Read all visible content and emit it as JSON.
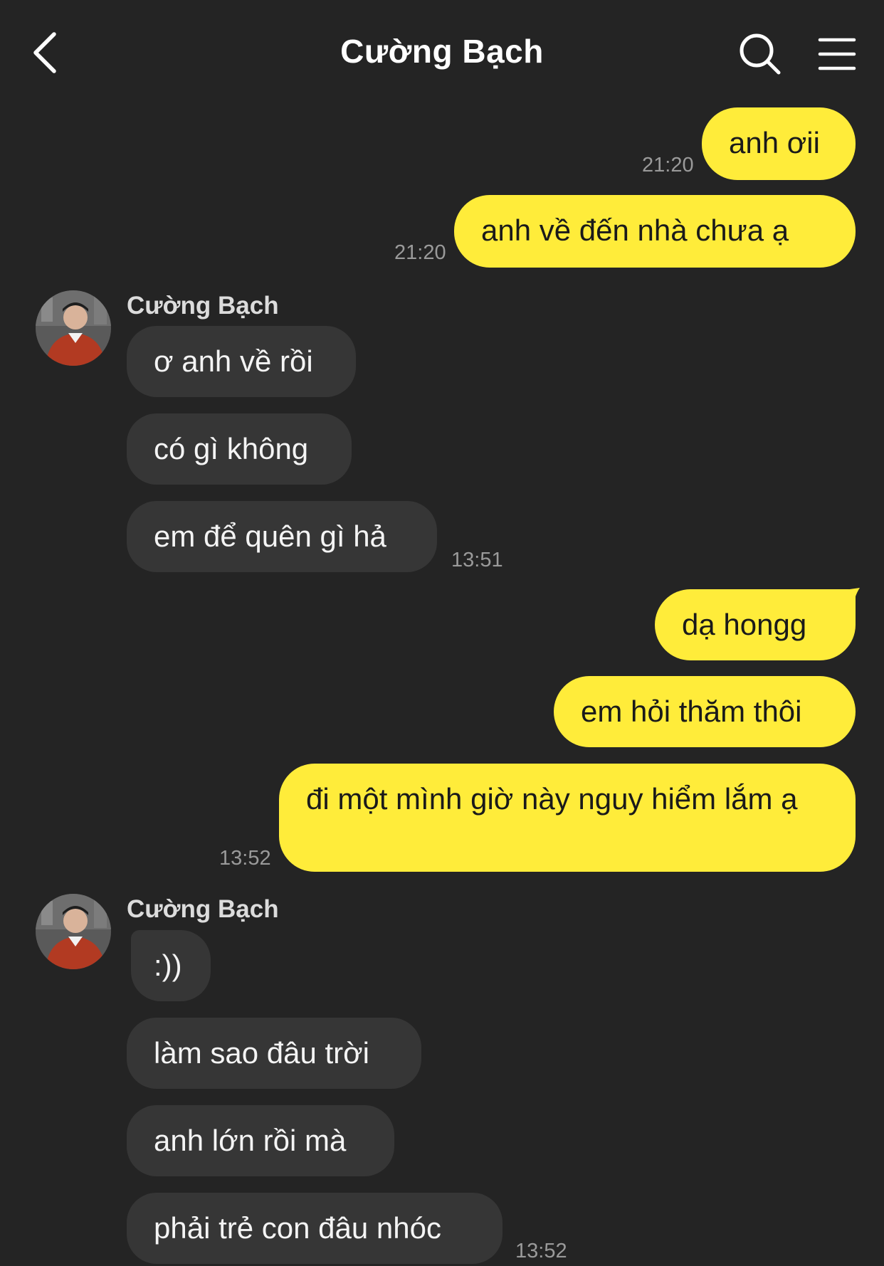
{
  "header": {
    "title": "Cường Bạch"
  },
  "messages": {
    "m1": {
      "text": "anh ơii",
      "time": "21:20"
    },
    "m2": {
      "text": "anh về đến nhà chưa ạ",
      "time": "21:20"
    },
    "group1": {
      "sender": "Cường Bạch",
      "m3": "ơ anh về rồi",
      "m4": "có gì không",
      "m5": "em để quên gì hả",
      "time": "13:51"
    },
    "m6": {
      "text": "dạ hongg"
    },
    "m7": {
      "text": "em hỏi thăm thôi"
    },
    "m8": {
      "text": "đi một mình giờ này nguy hiểm lắm ạ",
      "time": "13:52"
    },
    "group2": {
      "sender": "Cường Bạch",
      "m9": ":))",
      "m10": "làm sao đâu trời",
      "m11": "anh lớn rồi mà",
      "m12": "phải trẻ con đâu nhóc",
      "time": "13:52"
    }
  },
  "colors": {
    "background": "#242424",
    "outgoing_bubble": "#ffec3a",
    "incoming_bubble": "#363636"
  }
}
